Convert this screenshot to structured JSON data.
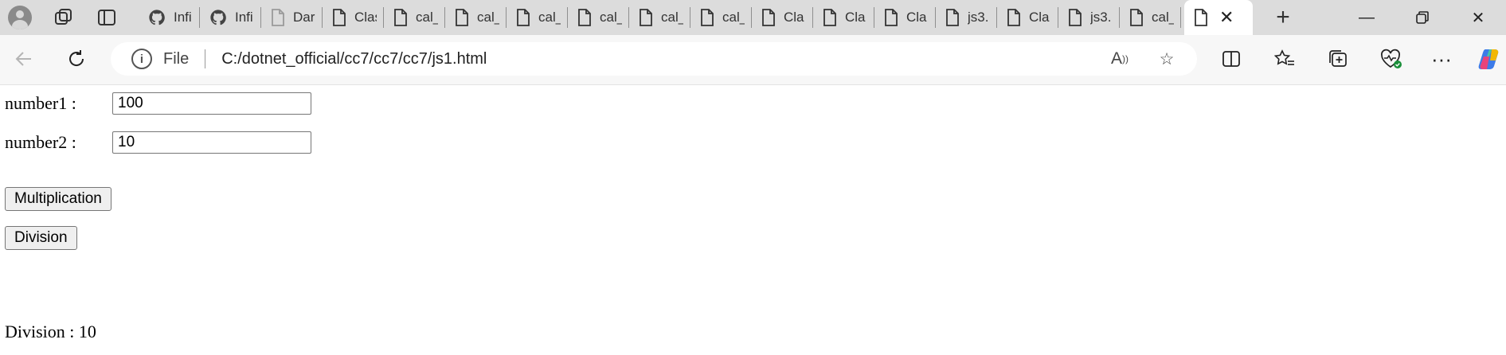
{
  "browser": {
    "tabs": [
      {
        "label": "Infi",
        "icon": "github-icon"
      },
      {
        "label": "Infi",
        "icon": "github-icon"
      },
      {
        "label": "Dar",
        "icon": "file-icon"
      },
      {
        "label": "Clas",
        "icon": "file-icon"
      },
      {
        "label": "cal_",
        "icon": "file-icon"
      },
      {
        "label": "cal_",
        "icon": "file-icon"
      },
      {
        "label": "cal_",
        "icon": "file-icon"
      },
      {
        "label": "cal_",
        "icon": "file-icon"
      },
      {
        "label": "cal_",
        "icon": "file-icon"
      },
      {
        "label": "cal_",
        "icon": "file-icon"
      },
      {
        "label": "Cla",
        "icon": "file-icon"
      },
      {
        "label": "Cla",
        "icon": "file-icon"
      },
      {
        "label": "Cla",
        "icon": "file-icon"
      },
      {
        "label": "js3.",
        "icon": "file-icon"
      },
      {
        "label": "Cla",
        "icon": "file-icon"
      },
      {
        "label": "js3.",
        "icon": "file-icon"
      },
      {
        "label": "cal_",
        "icon": "file-icon"
      }
    ],
    "address": {
      "scheme_label": "File",
      "url": "C:/dotnet_official/cc7/cc7/cc7/js1.html"
    }
  },
  "page": {
    "number1_label": "number1 :",
    "number1_value": "100",
    "number2_label": "number2 :",
    "number2_value": "10",
    "multiply_label": "Multiplication",
    "divide_label": "Division",
    "result_text": "Division : 10"
  }
}
